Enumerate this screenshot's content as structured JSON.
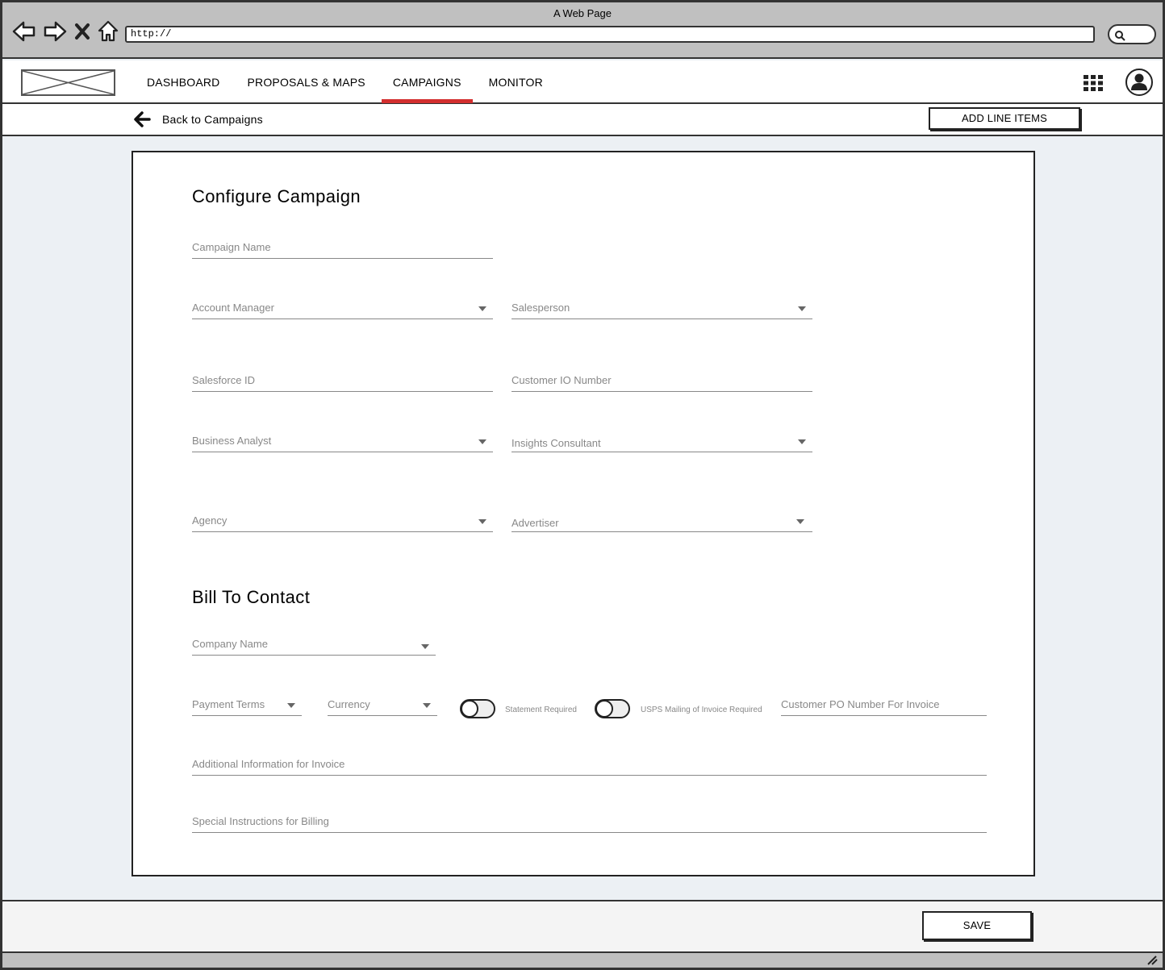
{
  "browser": {
    "title": "A Web Page",
    "url": "http://"
  },
  "header": {
    "tabs": [
      {
        "label": "DASHBOARD"
      },
      {
        "label": "PROPOSALS & MAPS"
      },
      {
        "label": "CAMPAIGNS"
      },
      {
        "label": "MONITOR"
      }
    ],
    "active_tab": "CAMPAIGNS",
    "accent_color": "#d32f2f"
  },
  "subbar": {
    "back_label": "Back to Campaigns",
    "add_line_items_label": "ADD LINE ITEMS"
  },
  "configure": {
    "title": "Configure Campaign",
    "campaign_name": "Campaign Name",
    "account_manager": "Account Manager",
    "salesperson": "Salesperson",
    "salesforce_id": "Salesforce ID",
    "customer_io_number": "Customer IO Number",
    "business_analyst": "Business Analyst",
    "insights_consultant": "Insights Consultant",
    "agency": "Agency",
    "advertiser": "Advertiser"
  },
  "bill_to": {
    "title": "Bill To Contact",
    "company_name": "Company Name",
    "payment_terms": "Payment Terms",
    "currency": "Currency",
    "statement_required": "Statement Required",
    "usps_mailing": "USPS Mailing of Invoice Required",
    "customer_po": "Customer PO Number For Invoice",
    "additional_info": "Additional Information for Invoice",
    "special_instructions": "Special Instructions for Billing"
  },
  "footer": {
    "save_label": "SAVE"
  }
}
